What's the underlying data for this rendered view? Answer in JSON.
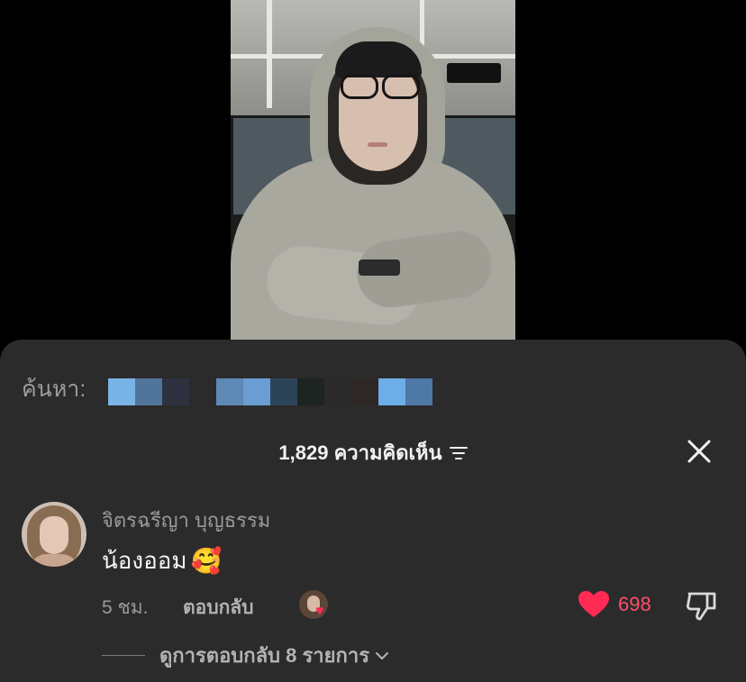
{
  "search": {
    "label": "ค้นหา:",
    "redacted_colors": [
      "#7ab3e6",
      "#51759a",
      "#2e3240",
      "#5e88b5",
      "#6a9dd1",
      "#2c4458",
      "#1d2421",
      "#2a2a2a",
      "#2d2826",
      "#6eaee8",
      "#4e78a6"
    ]
  },
  "comments_header": {
    "count_label": "1,829 ความคิดเห็น",
    "sort_icon": "sort-icon",
    "close_icon": "close-icon"
  },
  "comment": {
    "author": "จิตรฉรีญา บุญธรรม",
    "text": "น้องออม",
    "emoji": "🥰",
    "time": "5 ชม.",
    "reply_label": "ตอบกลับ",
    "like_count": "698",
    "liked": true,
    "like_color": "#ff2b55",
    "view_replies_label": "ดูการตอบกลับ 8 รายการ"
  }
}
